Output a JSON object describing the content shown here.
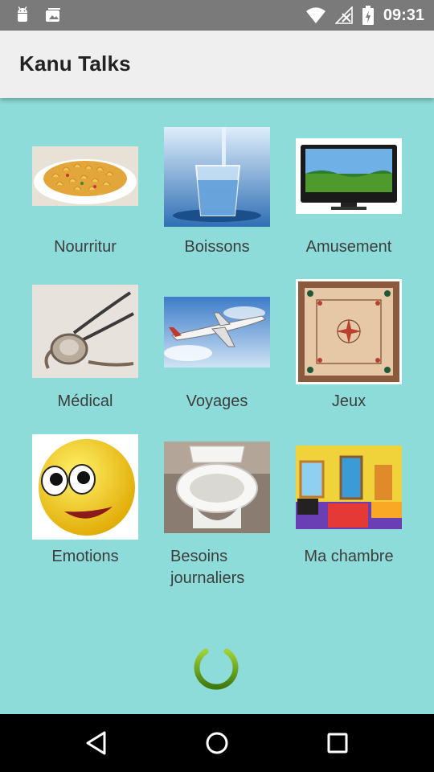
{
  "status_bar": {
    "time": "09:31",
    "icons": [
      "android-icon",
      "photos-icon",
      "wifi-icon",
      "no-signal-icon",
      "battery-icon"
    ]
  },
  "app_bar": {
    "title": "Kanu Talks"
  },
  "categories": [
    {
      "label": "Nourritur",
      "icon": "food-image"
    },
    {
      "label": "Boissons",
      "icon": "water-glass-image"
    },
    {
      "label": "Amusement",
      "icon": "television-image"
    },
    {
      "label": "Médical",
      "icon": "stethoscope-image"
    },
    {
      "label": "Voyages",
      "icon": "airplane-image"
    },
    {
      "label": "Jeux",
      "icon": "carrom-board-image"
    },
    {
      "label": "Emotions",
      "icon": "smiley-image"
    },
    {
      "label": "Besoins journaliers",
      "icon": "toilet-image"
    },
    {
      "label": "Ma chambre",
      "icon": "bedroom-image"
    }
  ],
  "power_button": {
    "icon": "power-icon",
    "color": "#5a9a14"
  },
  "nav_bar": {
    "icons": [
      "back-icon",
      "home-icon",
      "recents-icon"
    ]
  },
  "colors": {
    "background": "#8edcd9",
    "app_bar": "#efefef",
    "status_bar": "#7a7a7a",
    "text": "#3d3d3d"
  }
}
